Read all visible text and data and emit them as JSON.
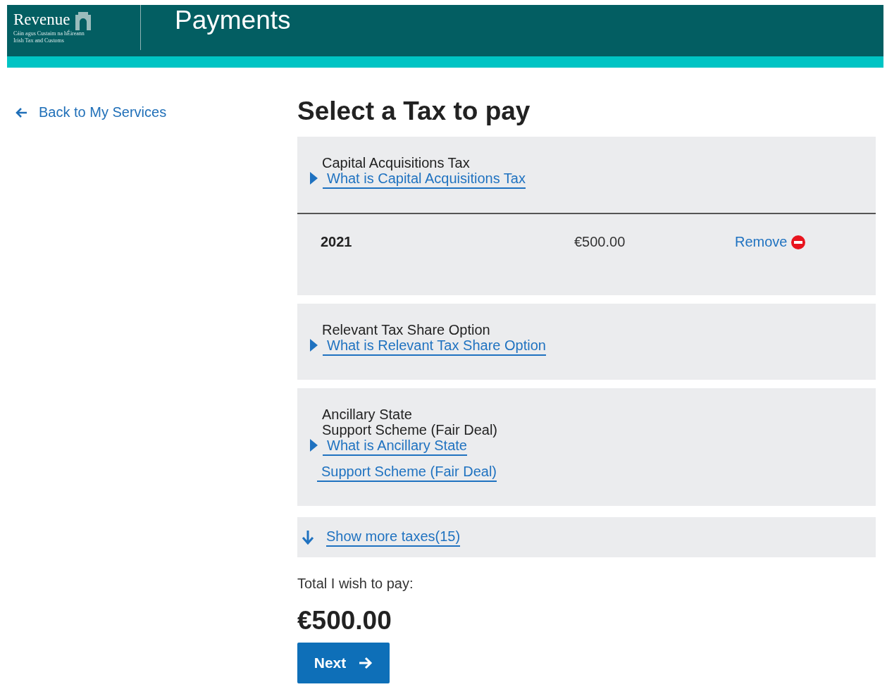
{
  "header": {
    "logo": {
      "name": "Revenue",
      "subtitle_lines": [
        "Cáin agus Custaim na hÉireann",
        "Irish Tax and Customs"
      ]
    },
    "title": "Payments"
  },
  "back_link": "Back to My Services",
  "heading": "Select a Tax to pay",
  "taxes": [
    {
      "name_lines": [
        "Capital Acquisitions Tax"
      ],
      "link_lines": [
        "What is Capital Acquisitions Tax"
      ],
      "entries": [
        {
          "year": "2021",
          "amount": "€500.00",
          "action": "Remove"
        }
      ]
    },
    {
      "name_lines": [
        "Relevant Tax Share Option"
      ],
      "link_lines": [
        "What is Relevant Tax Share Option"
      ]
    },
    {
      "name_lines": [
        "Ancillary State",
        "Support Scheme (Fair Deal)"
      ],
      "link_lines": [
        "What is Ancillary State",
        "Support Scheme (Fair Deal)"
      ]
    }
  ],
  "show_more": "Show more taxes(15)",
  "total_label": "Total I wish to pay:",
  "total_amount": "€500.00",
  "next_button": "Next"
}
